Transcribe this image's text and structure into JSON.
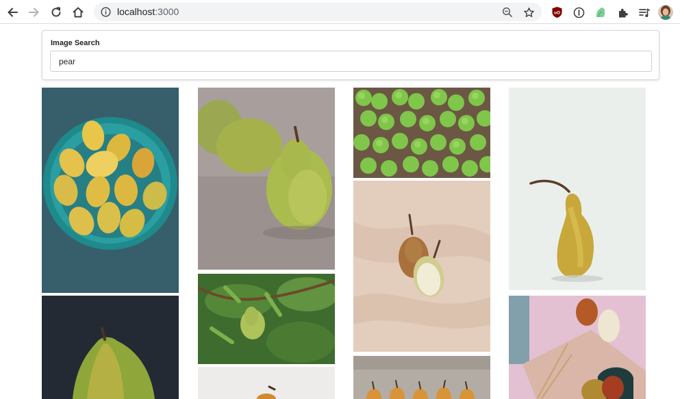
{
  "browser": {
    "url_host": "localhost",
    "url_port": ":3000",
    "icons": {
      "back": "arrow-left-icon",
      "forward": "arrow-right-icon",
      "reload": "reload-icon",
      "home": "home-icon",
      "info": "info-icon",
      "zoom": "zoom-out-icon",
      "bookmark": "star-icon",
      "extensions": [
        "ublock-origin-icon",
        "one-password-icon",
        "green-extension-icon",
        "puzzle-extensions-icon",
        "reading-list-icon",
        "profile-avatar-icon"
      ]
    },
    "ublock_badge": "uO"
  },
  "search": {
    "label": "Image Search",
    "value": "pear"
  },
  "gallery": {
    "photos": [
      {
        "id": "teal-bowl-yellow-pears",
        "subject": "pears"
      },
      {
        "id": "green-pear-grey",
        "subject": "pear"
      },
      {
        "id": "green-pears-crates",
        "subject": "pears"
      },
      {
        "id": "single-yellow-pear-white",
        "subject": "pear"
      },
      {
        "id": "pear-halves-cloth",
        "subject": "pears"
      },
      {
        "id": "pear-tree-branch",
        "subject": "pear"
      },
      {
        "id": "dark-green-pear",
        "subject": "pear"
      },
      {
        "id": "pink-wood-pears",
        "subject": "pears"
      },
      {
        "id": "pear-row",
        "subject": "pears"
      },
      {
        "id": "pear-on-light",
        "subject": "pear"
      }
    ]
  },
  "colors": {
    "chrome_bg": "#ffffff",
    "omnibox_bg": "#f1f3f4",
    "icon": "#5f6368"
  }
}
